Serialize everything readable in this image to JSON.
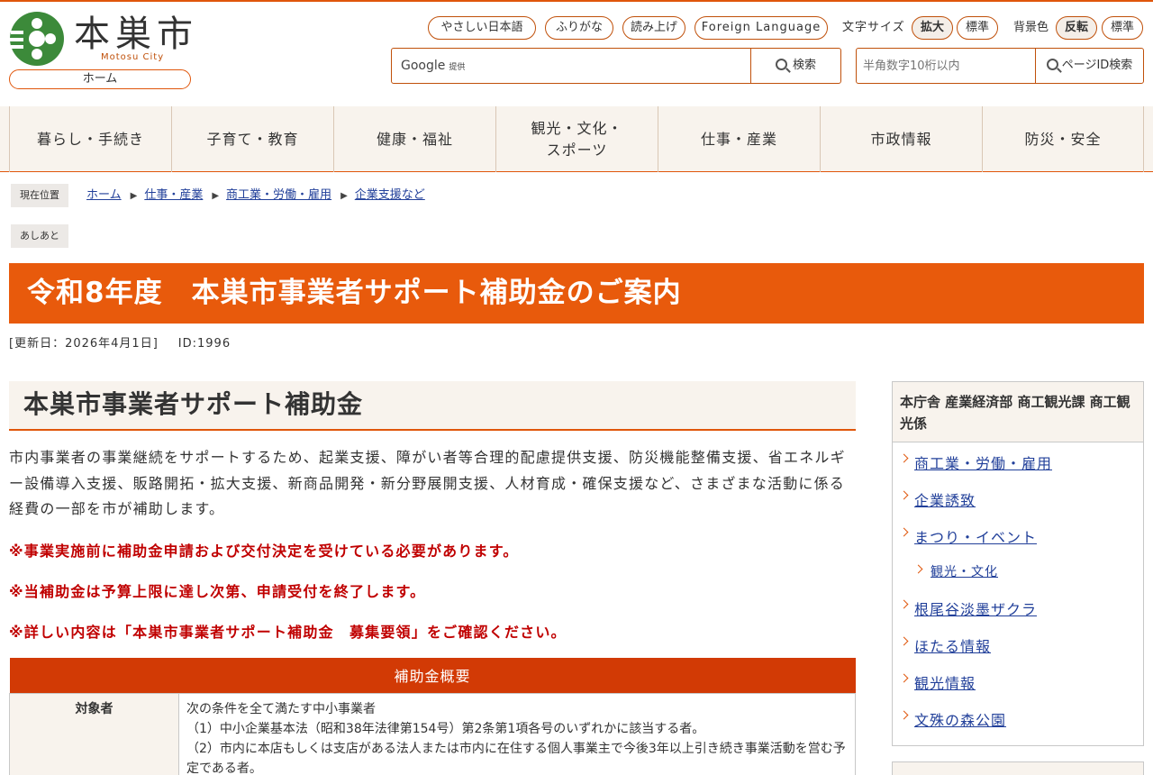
{
  "header": {
    "city_name": "本巣市",
    "city_name_en": "Motosu City",
    "home_label": "ホーム",
    "tools": {
      "easy_japanese": "やさしい日本語",
      "furigana": "ふりがな",
      "read_aloud": "読み上げ",
      "foreign_language": "Foreign Language",
      "font_size_label": "文字サイズ",
      "font_large": "拡大",
      "font_standard": "標準",
      "bg_label": "背景色",
      "bg_invert": "反転",
      "bg_standard": "標準"
    },
    "search": {
      "brand": "Google",
      "brand_sub": "提供",
      "button": "検索"
    },
    "page_id_search": {
      "placeholder": "半角数字10桁以内",
      "button": "ページID検索"
    },
    "brand_color": "#e0560b"
  },
  "nav": {
    "items": [
      {
        "label": "暮らし・手続き"
      },
      {
        "label": "子育て・教育"
      },
      {
        "label": "健康・福祉"
      },
      {
        "label": "観光・文化・\nスポーツ"
      },
      {
        "label": "仕事・産業"
      },
      {
        "label": "市政情報"
      },
      {
        "label": "防災・安全"
      }
    ]
  },
  "breadcrumb": {
    "label": "現在位置",
    "items": [
      "ホーム",
      "仕事・産業",
      "商工業・労働・雇用",
      "企業支援など"
    ],
    "history_label": "あしあと"
  },
  "page": {
    "title": "令和8年度　本巣市事業者サポート補助金のご案内",
    "updated": "[更新日：2026年4月1日]",
    "page_id": "ID:1996"
  },
  "main": {
    "heading": "本巣市事業者サポート補助金",
    "lead": "市内事業者の事業継続をサポートするため、起業支援、障がい者等合理的配慮提供支援、防災機能整備支援、省エネルギー設備導入支援、販路開拓・拡大支援、新商品開発・新分野展開支援、人材育成・確保支援など、さまざまな活動に係る経費の一部を市が補助します。",
    "notes": [
      "※事業実施前に補助金申請および交付決定を受けている必要があります。",
      "※当補助金は予算上限に達し次第、申請受付を終了します。",
      "※詳しい内容は「本巣市事業者サポート補助金　募集要領」をご確認ください。"
    ],
    "table": {
      "caption": "補助金概要",
      "rows": [
        {
          "label": "対象者",
          "lines": [
            "次の条件を全て満たす中小事業者",
            "（1）中小企業基本法（昭和38年法律第154号）第2条第1項各号のいずれかに該当する者。",
            "（2）市内に本店もしくは支店がある法人または市内に在住する個人事業主で今後3年以上引き続き事業活動を営む予定である者。"
          ]
        }
      ]
    }
  },
  "sidebar": {
    "department": "本庁舎 産業経済部 商工観光課 商工観光係",
    "links": [
      {
        "label": "商工業・労働・雇用"
      },
      {
        "label": "企業誘致"
      },
      {
        "label": "まつり・イベント"
      },
      {
        "label": "観光・文化"
      },
      {
        "label": "根尾谷淡墨ザクラ"
      },
      {
        "label": "ほたる情報"
      },
      {
        "label": "観光情報"
      },
      {
        "label": "文殊の森公園"
      }
    ]
  }
}
